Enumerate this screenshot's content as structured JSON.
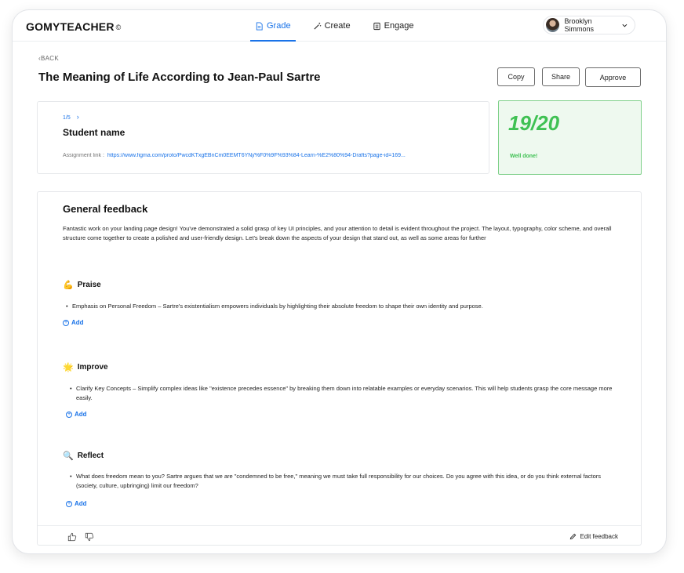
{
  "brand": {
    "logo": "GOMYTEACHER",
    "reg_mark": "©"
  },
  "nav": [
    {
      "label": "Grade",
      "icon": "document-icon",
      "active": true
    },
    {
      "label": "Create",
      "icon": "magic-wand-icon",
      "active": false
    },
    {
      "label": "Engage",
      "icon": "calendar-icon",
      "active": false
    }
  ],
  "user": {
    "name": "Brooklyn Simmons"
  },
  "back_label": "BACK",
  "page_title": "The Meaning of Life According to Jean-Paul Sartre",
  "actions": {
    "copy": "Copy",
    "share": "Share",
    "approve": "Approve"
  },
  "student": {
    "pager": "1/5",
    "name": "Student name",
    "assignment_label": "Assignment link :",
    "assignment_link": "https://www.figma.com/proto/PwcdKTxgEBnCm0EEMT6YNj/%F0%9F%93%84-Learn-%E2%80%94-Drafts?page-id=169..."
  },
  "score": {
    "value": "19/20",
    "message": "Well done!"
  },
  "feedback": {
    "title": "General feedback",
    "intro": "Fantastic work on your landing page design! You've demonstrated a solid grasp of key UI principles, and your attention to detail is evident throughout the project. The layout, typography, color scheme, and overall structure come together to create a polished and user-friendly design. Let's break down the aspects of your design that stand out, as well as some areas for further",
    "sections": [
      {
        "emoji": "💪",
        "title": "Praise",
        "bullets": [
          "Emphasis on Personal Freedom – Sartre's existentialism empowers individuals by highlighting their absolute freedom to shape their own identity and purpose."
        ],
        "add_label": "Add"
      },
      {
        "emoji": "🌟",
        "title": "Improve",
        "bullets": [
          "Clarify Key Concepts – Simplify complex ideas like \"existence precedes essence\" by breaking them down into relatable examples or everyday scenarios. This will help students grasp the core message more easily."
        ],
        "add_label": "Add"
      },
      {
        "emoji": "🔍",
        "title": "Reflect",
        "bullets": [
          "What does freedom mean to you? Sartre argues that we are \"condemned to be free,\" meaning we must take full responsibility for our choices. Do you agree with this idea, or do you think external factors (society, culture, upbringing) limit our freedom?"
        ],
        "add_label": "Add"
      }
    ],
    "edit_label": "Edit feedback"
  }
}
